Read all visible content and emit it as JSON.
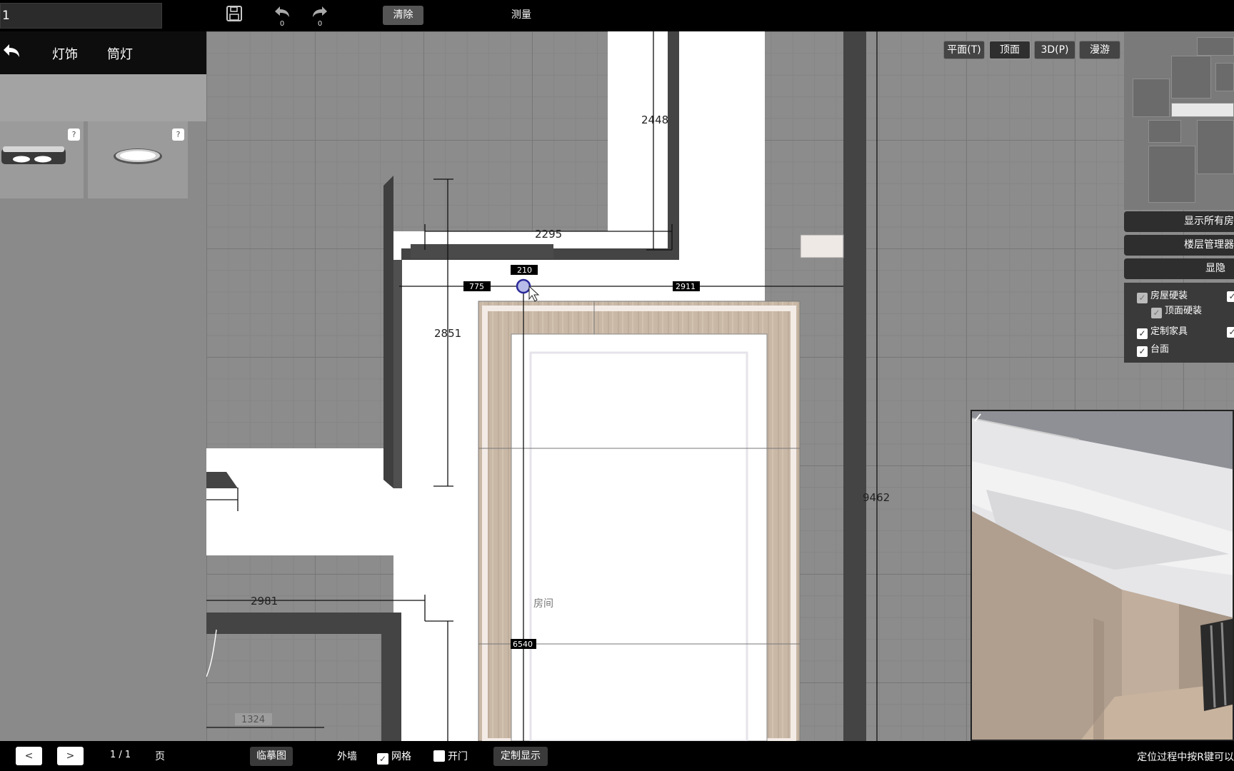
{
  "topbar": {
    "project_value": "1",
    "undo_count": "0",
    "redo_count": "0",
    "clear_label": "清除",
    "measure_label": "测量"
  },
  "left_panel": {
    "tabs": [
      "灯饰",
      "筒灯"
    ],
    "help_label": "?",
    "pager": {
      "prev": "<",
      "next": ">",
      "info": "1 / 1",
      "unit": "页"
    }
  },
  "view_modes": [
    "平面(T)",
    "顶面",
    "3D(P)",
    "漫游"
  ],
  "right_panel": {
    "buttons": [
      "显示所有房",
      "楼层管理器",
      "显隐"
    ],
    "checkboxes": [
      {
        "label": "房屋硬装",
        "checked": true,
        "dimmed": true
      },
      {
        "label": "顶面硬装",
        "checked": true,
        "dimmed": true
      },
      {
        "label": "定制家具",
        "checked": true,
        "dimmed": false
      },
      {
        "label": "台面",
        "checked": true,
        "dimmed": false
      }
    ]
  },
  "plan": {
    "dimensions": [
      "2448",
      "2295",
      "210",
      "775",
      "2911",
      "2851",
      "9462",
      "2981",
      "6540",
      "1324"
    ],
    "room_label": "房间"
  },
  "bottom_bar": {
    "trace_button": "临摹图",
    "checkboxes": [
      {
        "label": "外墙",
        "checked": false
      },
      {
        "label": "网格",
        "checked": true
      },
      {
        "label": "开门",
        "checked": false
      }
    ],
    "custom_display_button": "定制显示",
    "hint": "定位过程中按R键可以"
  }
}
